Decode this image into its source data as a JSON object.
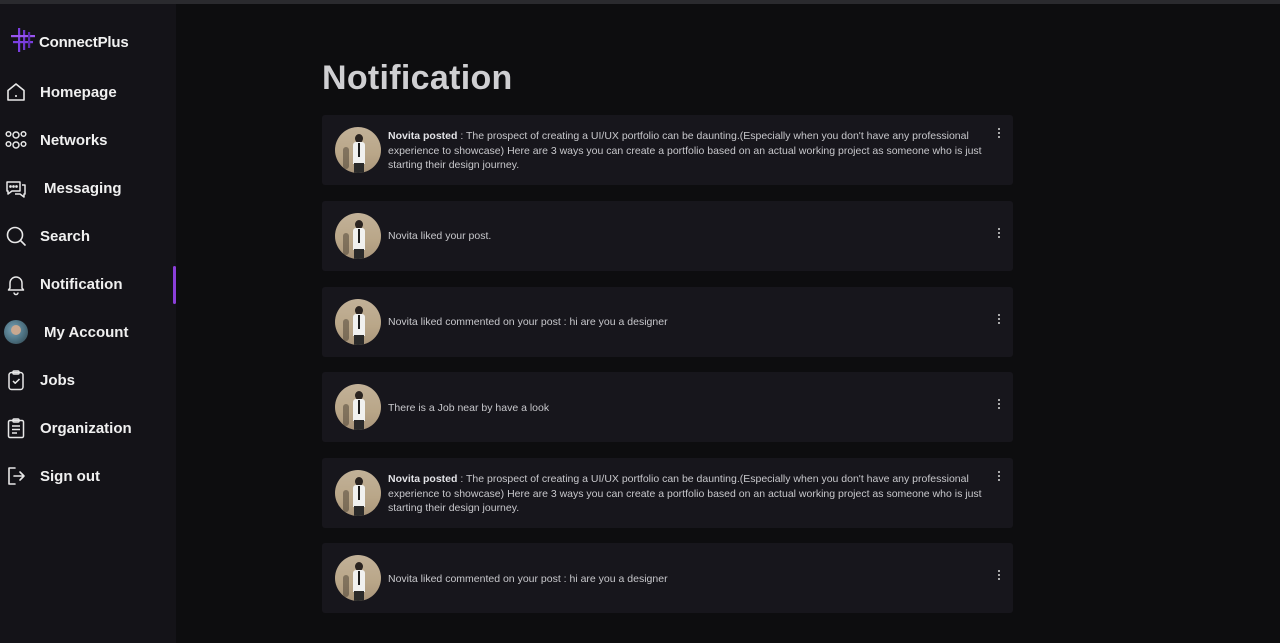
{
  "app": {
    "name": "ConnectPlus"
  },
  "sidebar": {
    "items": [
      {
        "label": "Homepage",
        "icon": "home-icon"
      },
      {
        "label": "Networks",
        "icon": "network-icon"
      },
      {
        "label": "Messaging",
        "icon": "chat-icon"
      },
      {
        "label": "Search",
        "icon": "search-icon"
      },
      {
        "label": "Notification",
        "icon": "bell-icon",
        "active": true
      },
      {
        "label": "My Account",
        "icon": "avatar"
      },
      {
        "label": "Jobs",
        "icon": "clipboard-check-icon"
      },
      {
        "label": "Organization",
        "icon": "document-icon"
      },
      {
        "label": "Sign out",
        "icon": "sign-out-icon"
      }
    ]
  },
  "colors": {
    "accent": "#8b3fd9",
    "background": "#0d0d0f",
    "sidebar": "#141318",
    "card": "#17161c"
  },
  "page": {
    "title": "Notification"
  },
  "notifications": [
    {
      "actor": "Novita posted",
      "text": " : The prospect of creating a UI/UX portfolio can be daunting.(Especially when you don't have any professional experience to showcase) Here are 3 ways you can create a portfolio based on an actual working project as someone who is just starting their design journey."
    },
    {
      "actor": "",
      "text": "Novita liked your post."
    },
    {
      "actor": "",
      "text": "Novita liked commented on your post : hi are you a designer"
    },
    {
      "actor": "",
      "text": "There is a Job near by have a look"
    },
    {
      "actor": "Novita posted",
      "text": " : The prospect of creating a UI/UX portfolio can be daunting.(Especially when you don't have any professional experience to showcase) Here are 3 ways you can create a portfolio based on an actual working project as someone who is just starting their design journey."
    },
    {
      "actor": "",
      "text": "Novita liked commented on your post : hi are you a designer"
    }
  ]
}
